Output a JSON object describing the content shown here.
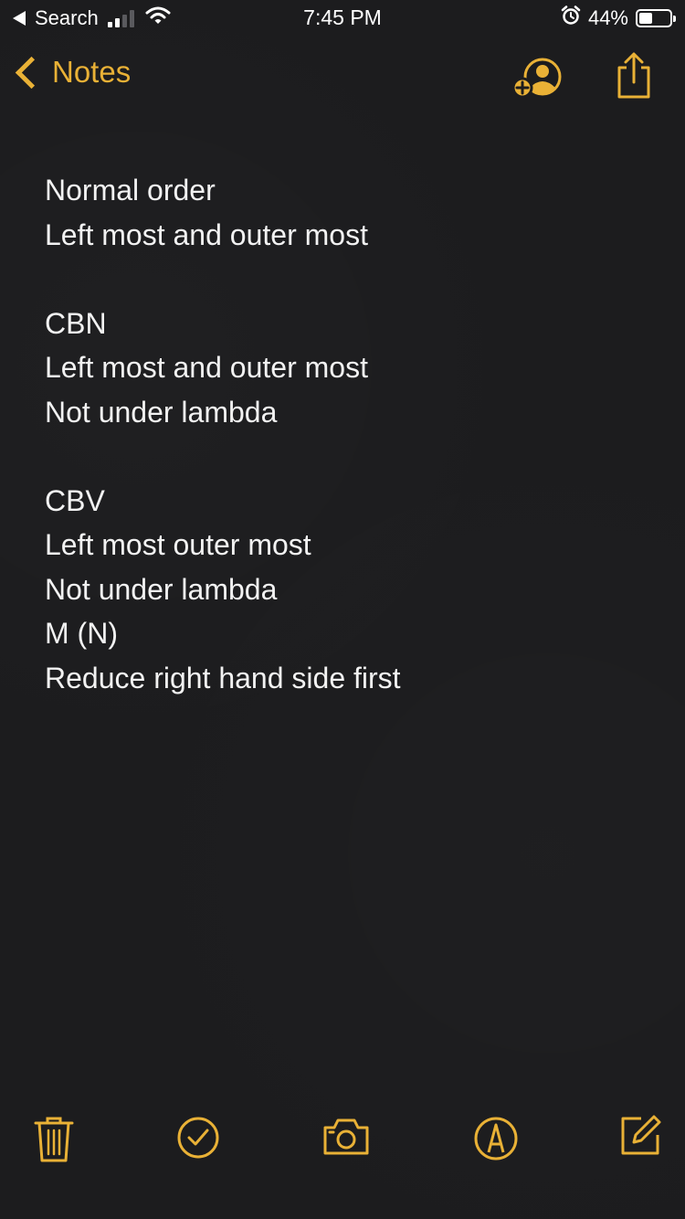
{
  "status_bar": {
    "back_app_label": "Search",
    "time": "7:45 PM",
    "battery_percent": "44%",
    "battery_level": 0.44,
    "icons": [
      "back-triangle-icon",
      "signal-icon",
      "wifi-icon",
      "alarm-icon",
      "battery-icon"
    ]
  },
  "nav": {
    "back_label": "Notes",
    "icons": [
      "chevron-left-icon",
      "add-person-icon",
      "share-icon"
    ]
  },
  "note": {
    "lines": [
      "Normal order",
      "Left most and outer most",
      "",
      "CBN",
      "Left most and outer most",
      "Not under lambda",
      "",
      "CBV",
      "Left most outer most",
      "Not under lambda",
      "M (N)",
      "Reduce right hand side first"
    ]
  },
  "toolbar": {
    "icons": [
      "trash-icon",
      "checklist-icon",
      "camera-icon",
      "markup-icon",
      "compose-icon"
    ]
  },
  "colors": {
    "accent": "#e9b136",
    "background": "#1c1c1e",
    "text": "#f2f2f2"
  }
}
